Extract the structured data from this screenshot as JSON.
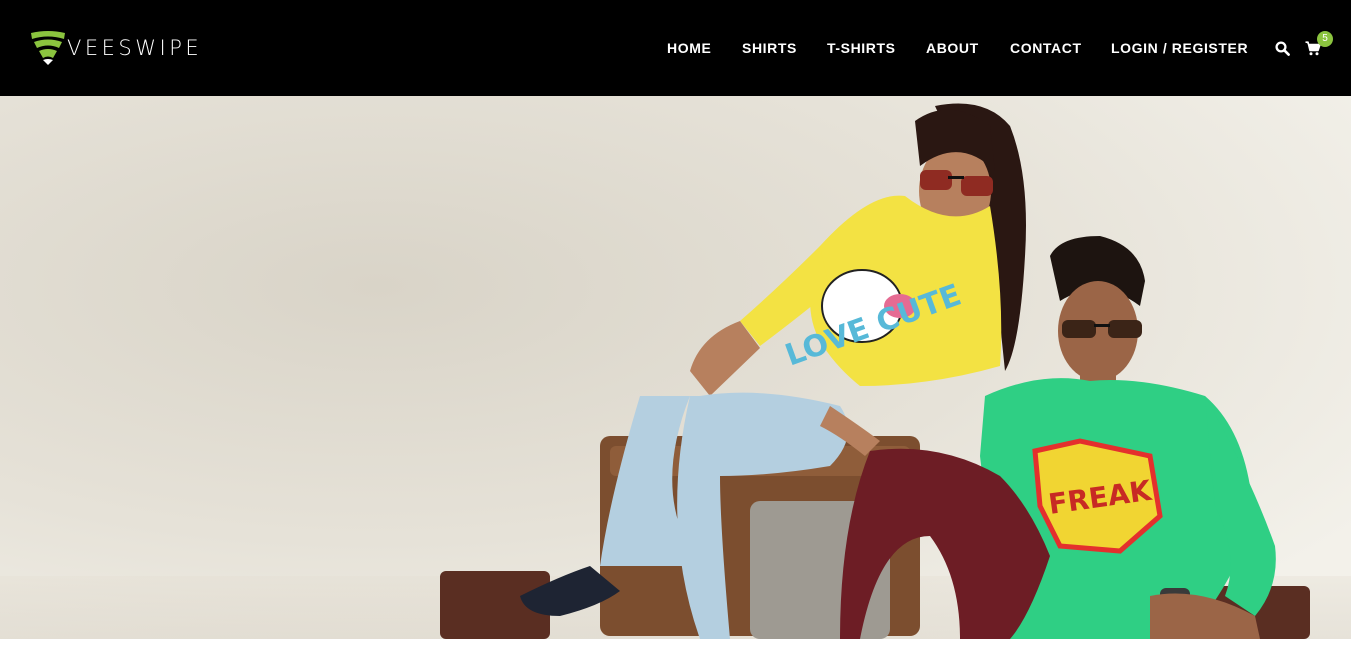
{
  "brand": {
    "name": "VEESWIPE",
    "logo_icon": "wifi-shield-icon",
    "accent": "#8bc43f"
  },
  "nav": {
    "items": [
      {
        "label": "HOME"
      },
      {
        "label": "SHIRTS"
      },
      {
        "label": "T-SHIRTS"
      },
      {
        "label": "ABOUT"
      },
      {
        "label": "CONTACT"
      },
      {
        "label": "LOGIN / REGISTER"
      }
    ],
    "search_icon": "search-icon",
    "cart_icon": "shopping-cart-icon",
    "cart_count": "5"
  },
  "hero": {
    "image": "hero-banner-photo",
    "shirt_prints": {
      "female": "LOVE CUTE",
      "male": "FREAK"
    }
  },
  "colors": {
    "header_bg": "#000000",
    "nav_text": "#ffffff",
    "badge": "#8bc43f"
  }
}
